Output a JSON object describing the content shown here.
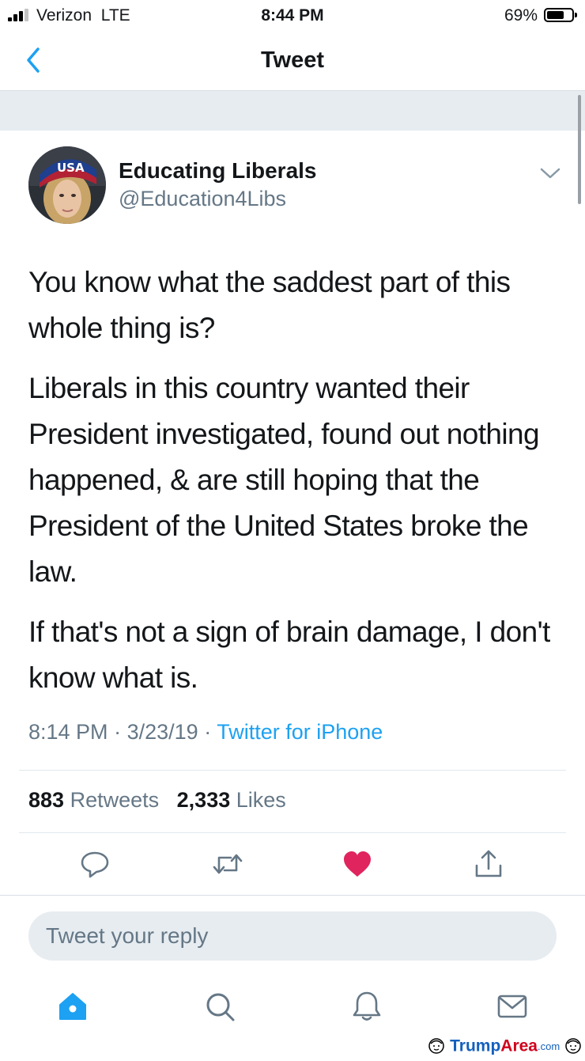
{
  "status_bar": {
    "carrier": "Verizon",
    "network": "LTE",
    "time": "8:44 PM",
    "battery_percent": "69%",
    "battery_level": 0.69,
    "signal_bars": 3
  },
  "nav": {
    "title": "Tweet",
    "back_icon": "chevron-left-icon"
  },
  "author": {
    "name": "Educating Liberals",
    "handle": "@Education4Libs",
    "avatar_hat_text": "USA"
  },
  "tweet": {
    "paragraphs": [
      "You know what the saddest part of this whole thing is?",
      "Liberals in this country wanted their President investigated, found out nothing happened, & are still hoping that the President of the United States broke the law.",
      "If that's not a sign of brain damage, I don't know what is."
    ],
    "time": "8:14 PM",
    "date": "3/23/19",
    "separator": "·",
    "source": "Twitter for iPhone"
  },
  "stats": {
    "retweets_count": "883",
    "retweets_label": "Retweets",
    "likes_count": "2,333",
    "likes_label": "Likes"
  },
  "actions": {
    "reply_icon": "reply-icon",
    "retweet_icon": "retweet-icon",
    "like_icon": "heart-icon",
    "share_icon": "share-icon",
    "liked": true
  },
  "reply": {
    "placeholder": "Tweet your reply"
  },
  "tab_bar": {
    "items": [
      "home-icon",
      "search-icon",
      "notifications-icon",
      "messages-icon"
    ],
    "active": "home-icon"
  },
  "watermark": {
    "name_part1": "Trump",
    "name_part2": "Area",
    "domain": ".com"
  },
  "colors": {
    "accent": "#1da1f2",
    "like": "#e0245e",
    "muted_text": "#657786",
    "divider": "#e1e8ed",
    "band": "#e6ecf0"
  }
}
